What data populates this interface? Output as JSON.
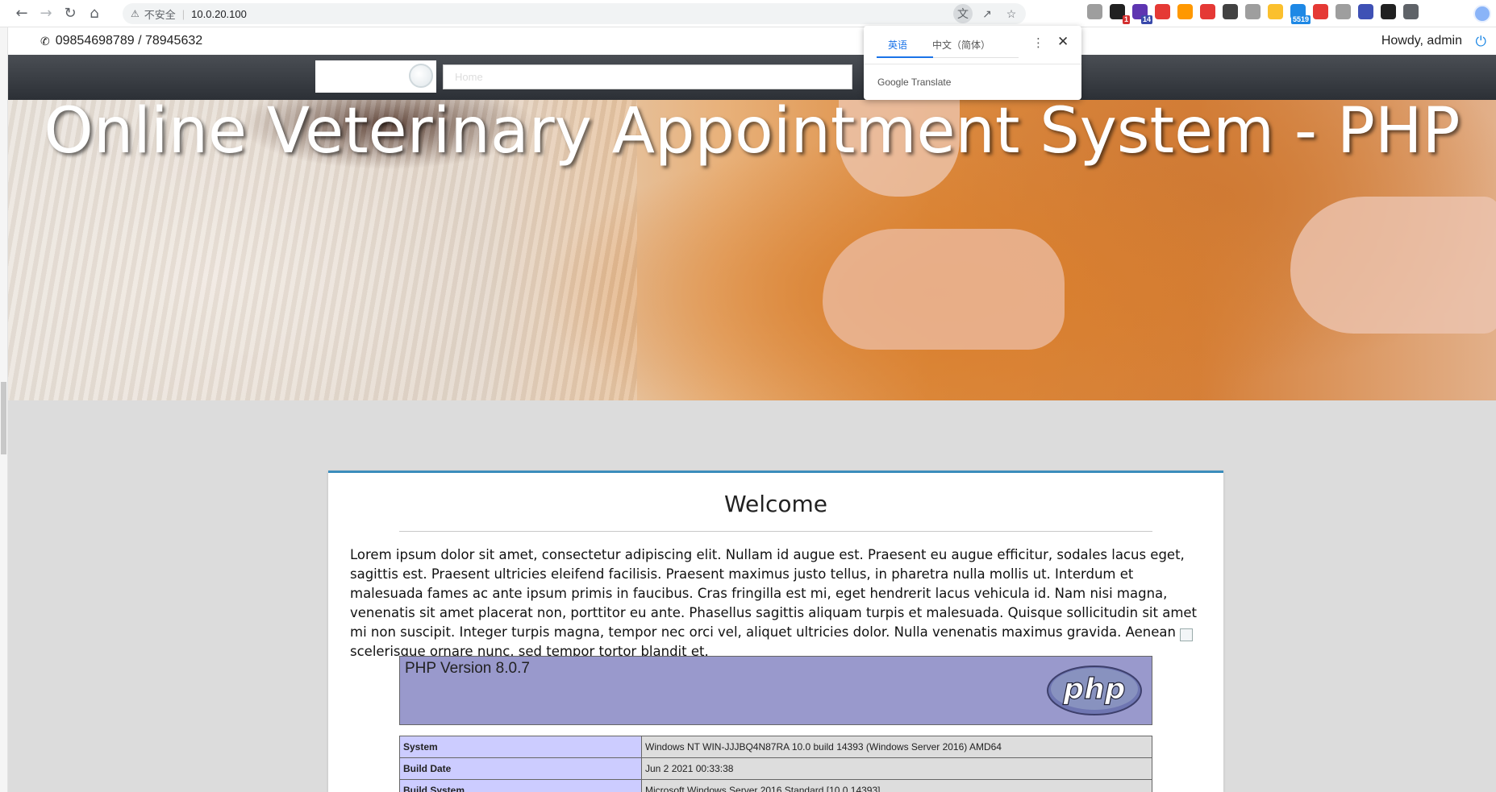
{
  "browser": {
    "security_label": "不安全",
    "url": "10.0.20.100",
    "extensions": [
      {
        "name": "ext-1",
        "color": "#9e9e9e",
        "badge": ""
      },
      {
        "name": "ext-2",
        "color": "#212121",
        "badge": "1",
        "badge_color": "#d32f2f"
      },
      {
        "name": "ext-3",
        "color": "#5e35b1",
        "badge": "14",
        "badge_color": "#3949ab"
      },
      {
        "name": "ext-4",
        "color": "#e53935",
        "badge": ""
      },
      {
        "name": "ext-5",
        "color": "#ff9800",
        "badge": ""
      },
      {
        "name": "ext-6",
        "color": "#e53935",
        "badge": ""
      },
      {
        "name": "ext-7",
        "color": "#424242",
        "badge": ""
      },
      {
        "name": "ext-8",
        "color": "#9e9e9e",
        "badge": ""
      },
      {
        "name": "ext-9",
        "color": "#fbc02d",
        "badge": ""
      },
      {
        "name": "ext-10",
        "color": "#1e88e5",
        "badge": "5519",
        "badge_color": "#1e88e5"
      },
      {
        "name": "ext-11",
        "color": "#e53935",
        "badge": ""
      },
      {
        "name": "ext-12",
        "color": "#9e9e9e",
        "badge": ""
      },
      {
        "name": "ext-13",
        "color": "#3f51b5",
        "badge": ""
      },
      {
        "name": "ext-14",
        "color": "#212121",
        "badge": ""
      },
      {
        "name": "ext-15",
        "color": "#5f6368",
        "badge": ""
      }
    ]
  },
  "translate": {
    "tab_source": "英语",
    "tab_target": "中文（简体）",
    "brand": "Google Translate"
  },
  "topbar": {
    "phone": "09854698789 / 78945632",
    "greeting": "Howdy, admin"
  },
  "nav": {
    "menu_placeholder": "Home"
  },
  "hero": {
    "title": "Online Veterinary Appointment System - PHP"
  },
  "content": {
    "heading": "Welcome",
    "body": "Lorem ipsum dolor sit amet, consectetur adipiscing elit. Nullam id augue est. Praesent eu augue efficitur, sodales lacus eget, sagittis est. Praesent ultricies eleifend facilisis. Praesent maximus justo tellus, in pharetra nulla mollis ut. Interdum et malesuada fames ac ante ipsum primis in faucibus. Cras fringilla est mi, eget hendrerit lacus vehicula id. Nam nisi magna, venenatis sit amet placerat non, porttitor eu ante. Phasellus sagittis aliquam turpis et malesuada. Quisque sollicitudin sit amet mi non suscipit. Integer turpis magna, tempor nec orci vel, aliquet ultricies dolor. Nulla venenatis maximus gravida. Aenean scelerisque ornare nunc, sed tempor tortor blandit et."
  },
  "phpinfo": {
    "version": "PHP Version 8.0.7",
    "logo_text": "php",
    "rows": [
      {
        "key": "System",
        "value": "Windows NT WIN-JJJBQ4N87RA 10.0 build 14393 (Windows Server 2016) AMD64"
      },
      {
        "key": "Build Date",
        "value": "Jun 2 2021 00:33:38"
      },
      {
        "key": "Build System",
        "value": "Microsoft Windows Server 2016 Standard [10.0.14393]"
      }
    ]
  },
  "colors": {
    "accent": "#3c8dbc",
    "php_header": "#9999cc",
    "php_key": "#ccccff",
    "php_value": "#dddddd"
  }
}
